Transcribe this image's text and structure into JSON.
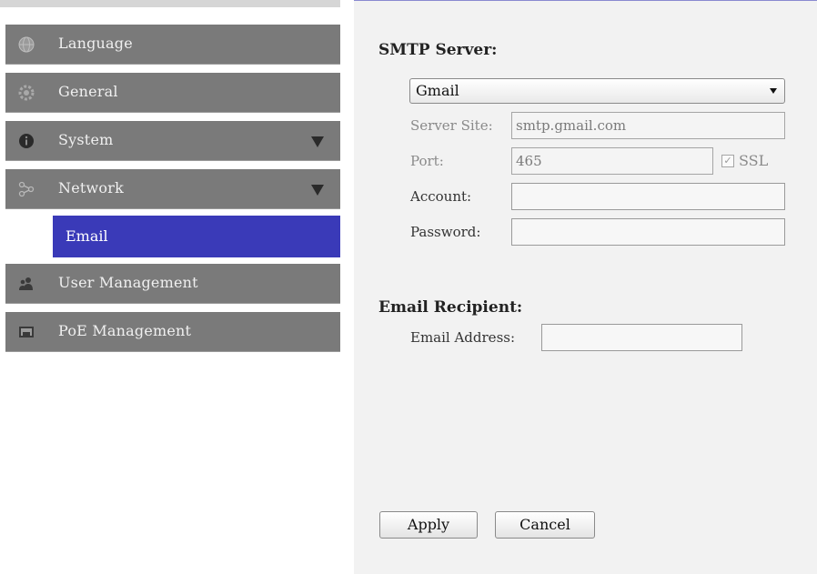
{
  "sidebar": {
    "items": [
      {
        "label": "Language",
        "icon": "globe-icon"
      },
      {
        "label": "General",
        "icon": "gear-icon"
      },
      {
        "label": "System",
        "icon": "info-icon"
      },
      {
        "label": "Network",
        "icon": "network-icon"
      },
      {
        "label": "User Management",
        "icon": "users-icon"
      },
      {
        "label": "PoE Management",
        "icon": "poe-icon"
      }
    ],
    "sub_item": {
      "label": "Email"
    },
    "colors": {
      "item_bg": "#7a7a7a",
      "active_bg": "#3a3ab8"
    }
  },
  "smtp": {
    "title": "SMTP Server:",
    "provider": "Gmail",
    "server_site_label": "Server Site:",
    "server_site_value": "smtp.gmail.com",
    "port_label": "Port:",
    "port_value": "465",
    "ssl_label": "SSL",
    "ssl_checked": true,
    "account_label": "Account:",
    "account_value": "",
    "password_label": "Password:",
    "password_value": ""
  },
  "recipient": {
    "title": "Email Recipient:",
    "address_label": "Email Address:",
    "address_value": ""
  },
  "buttons": {
    "apply": "Apply",
    "cancel": "Cancel"
  }
}
